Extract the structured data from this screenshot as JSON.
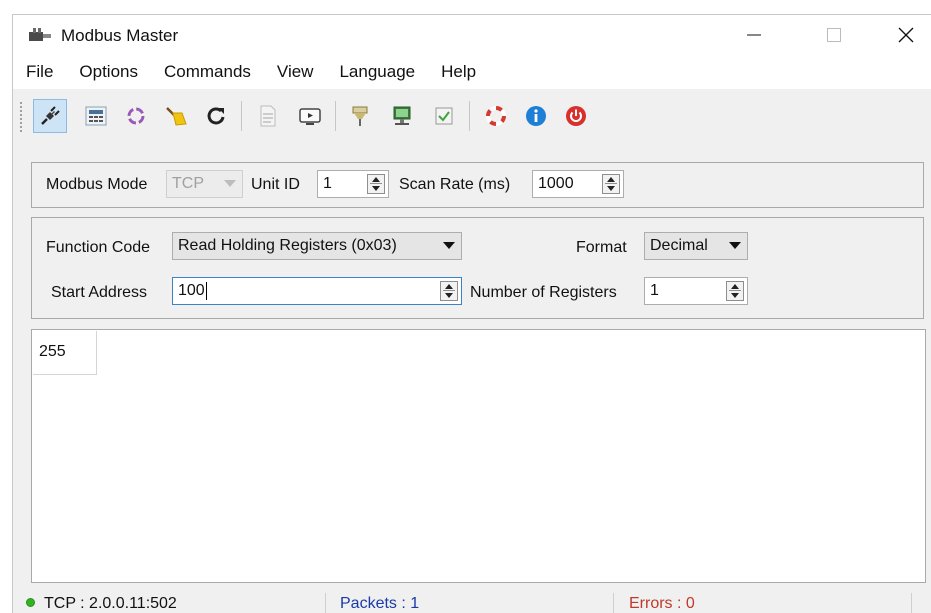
{
  "window": {
    "title": "Modbus Master"
  },
  "menu": [
    "File",
    "Options",
    "Commands",
    "View",
    "Language",
    "Help"
  ],
  "toolbar": {
    "icons": [
      "connect-icon",
      "rtu-settings-icon",
      "tcp-settings-icon",
      "clear-icon",
      "refresh-icon",
      "log-icon",
      "monitor-icon",
      "bus-monitor-icon",
      "tools-icon",
      "checklist-icon",
      "help-ring-icon",
      "info-icon",
      "exit-icon"
    ],
    "active": "connect-icon"
  },
  "connection": {
    "mode_label": "Modbus Mode",
    "mode_value": "TCP",
    "unit_id_label": "Unit ID",
    "unit_id_value": "1",
    "scan_rate_label": "Scan Rate (ms)",
    "scan_rate_value": "1000"
  },
  "request": {
    "function_code_label": "Function Code",
    "function_code_value": "Read Holding Registers (0x03)",
    "format_label": "Format",
    "format_value": "Decimal",
    "start_address_label": "Start Address",
    "start_address_value": "100",
    "num_registers_label": "Number of Registers",
    "num_registers_value": "1"
  },
  "output": {
    "values": [
      "255"
    ]
  },
  "status": {
    "connection": "TCP : 2.0.0.11:502",
    "packets": "Packets : 1",
    "errors": "Errors : 0"
  },
  "colors": {
    "packets": "#1a3aa8",
    "errors": "#c0392b",
    "led": "#2fb51f",
    "toolbar_active": "#cde4f7"
  }
}
